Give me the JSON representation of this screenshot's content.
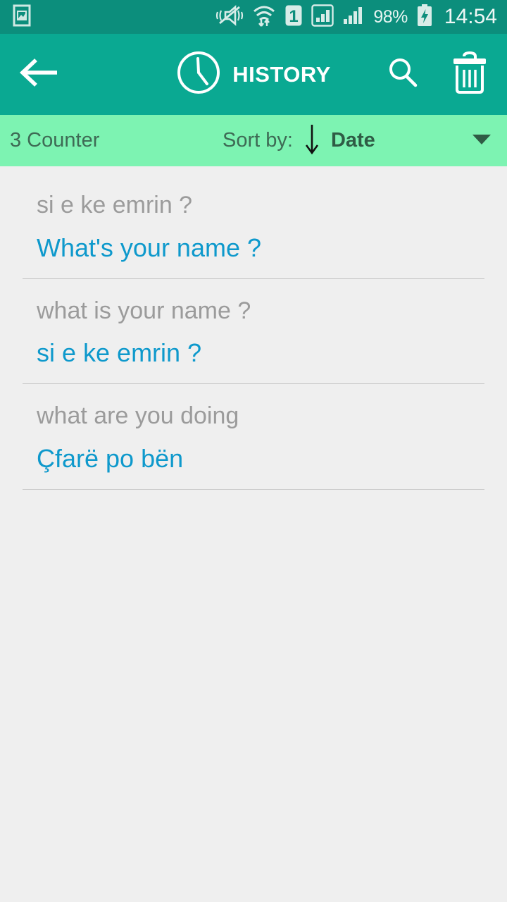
{
  "status_bar": {
    "notification_icon": "image-notification-icon",
    "icons": [
      "vibrate-mute-icon",
      "wifi-transfer-icon",
      "sim-one-icon",
      "signal-sim1-icon",
      "signal-sim2-icon"
    ],
    "battery_percent": "98%",
    "battery_icon": "battery-charging-icon",
    "time": "14:54",
    "background_color": "#0c8e7c"
  },
  "toolbar": {
    "back_icon": "arrow-left-icon",
    "clock_icon": "clock-icon",
    "title": "HISTORY",
    "search_icon": "search-icon",
    "delete_icon": "trash-icon",
    "background_color": "#0aa992"
  },
  "sort_bar": {
    "counter": "3 Counter",
    "sort_by_label": "Sort by:",
    "sort_direction_icon": "arrow-down-icon",
    "sort_value": "Date",
    "dropdown_icon": "triangle-down-icon",
    "background_color": "#7df3b2"
  },
  "history": {
    "items": [
      {
        "source": "si e ke emrin ?",
        "target": "What's your name ?"
      },
      {
        "source": "what is your name ?",
        "target": "si e ke emrin ?"
      },
      {
        "source": "what are you doing",
        "target": "Çfarë po bën"
      }
    ],
    "source_color": "#9b9b9b",
    "target_color": "#0e99cc",
    "background_color": "#efefef"
  }
}
